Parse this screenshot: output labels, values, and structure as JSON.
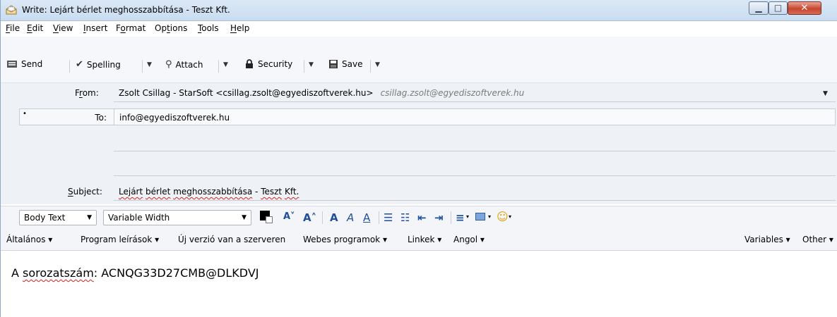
{
  "window": {
    "title": "Write: Lejárt bérlet meghosszabbítása - Teszt Kft.",
    "min_glyph": "▁",
    "max_glyph": "□",
    "close_glyph": "✕"
  },
  "menu": {
    "items": [
      {
        "acc": "F",
        "rest": "ile"
      },
      {
        "acc": "E",
        "rest": "dit"
      },
      {
        "acc": "V",
        "rest": "iew"
      },
      {
        "acc": "I",
        "rest": "nsert"
      },
      {
        "pre": "F",
        "acc": "o",
        "rest": "rmat"
      },
      {
        "pre": "Op",
        "acc": "t",
        "rest": "ions"
      },
      {
        "acc": "T",
        "rest": "ools"
      },
      {
        "acc": "H",
        "rest": "elp"
      }
    ]
  },
  "toolbar": {
    "send_label": "Send",
    "spelling_label": "Spelling",
    "attach_label": "Attach",
    "security_label": "Security",
    "save_label": "Save",
    "arrow": "▼"
  },
  "header": {
    "from_label_pre": "F",
    "from_label_acc": "r",
    "from_label_rest": "om:",
    "from_value": "Zsolt Csillag - StarSoft <csillag.zsolt@egyediszoftverek.hu>",
    "from_sub": "csillag.zsolt@egyediszoftverek.hu",
    "to_label": "To:",
    "to_value": "info@egyediszoftverek.hu",
    "subject_label_acc": "S",
    "subject_label_rest": "ubject:",
    "subject_parts": [
      {
        "text": "Lejárt",
        "spell": true
      },
      {
        "text": " ",
        "spell": false
      },
      {
        "text": "bérlet",
        "spell": true
      },
      {
        "text": " ",
        "spell": false
      },
      {
        "text": "meghosszabbítása",
        "spell": true
      },
      {
        "text": " - ",
        "spell": false
      },
      {
        "text": "Teszt",
        "spell": true
      },
      {
        "text": " ",
        "spell": false
      },
      {
        "text": "Kft.",
        "spell": true
      }
    ]
  },
  "format": {
    "paragraph_style": "Body Text",
    "font": "Variable Width",
    "arrow": "▼"
  },
  "templates": {
    "items": [
      "Általános ▾",
      "Program leírások ▾",
      "Új verzió van a szerveren",
      "Webes programok ▾",
      "Linkek ▾",
      "Angol ▾"
    ],
    "variables": "Variables ▾",
    "other": "Other ▾"
  },
  "body": {
    "prefix": "A ",
    "misspelled": "sorozatszám",
    "rest": ": ACNQG33D27CMB@DLKDVJ"
  },
  "colors": {
    "accent": "#1f4f9c",
    "spell_error": "#d62020"
  }
}
